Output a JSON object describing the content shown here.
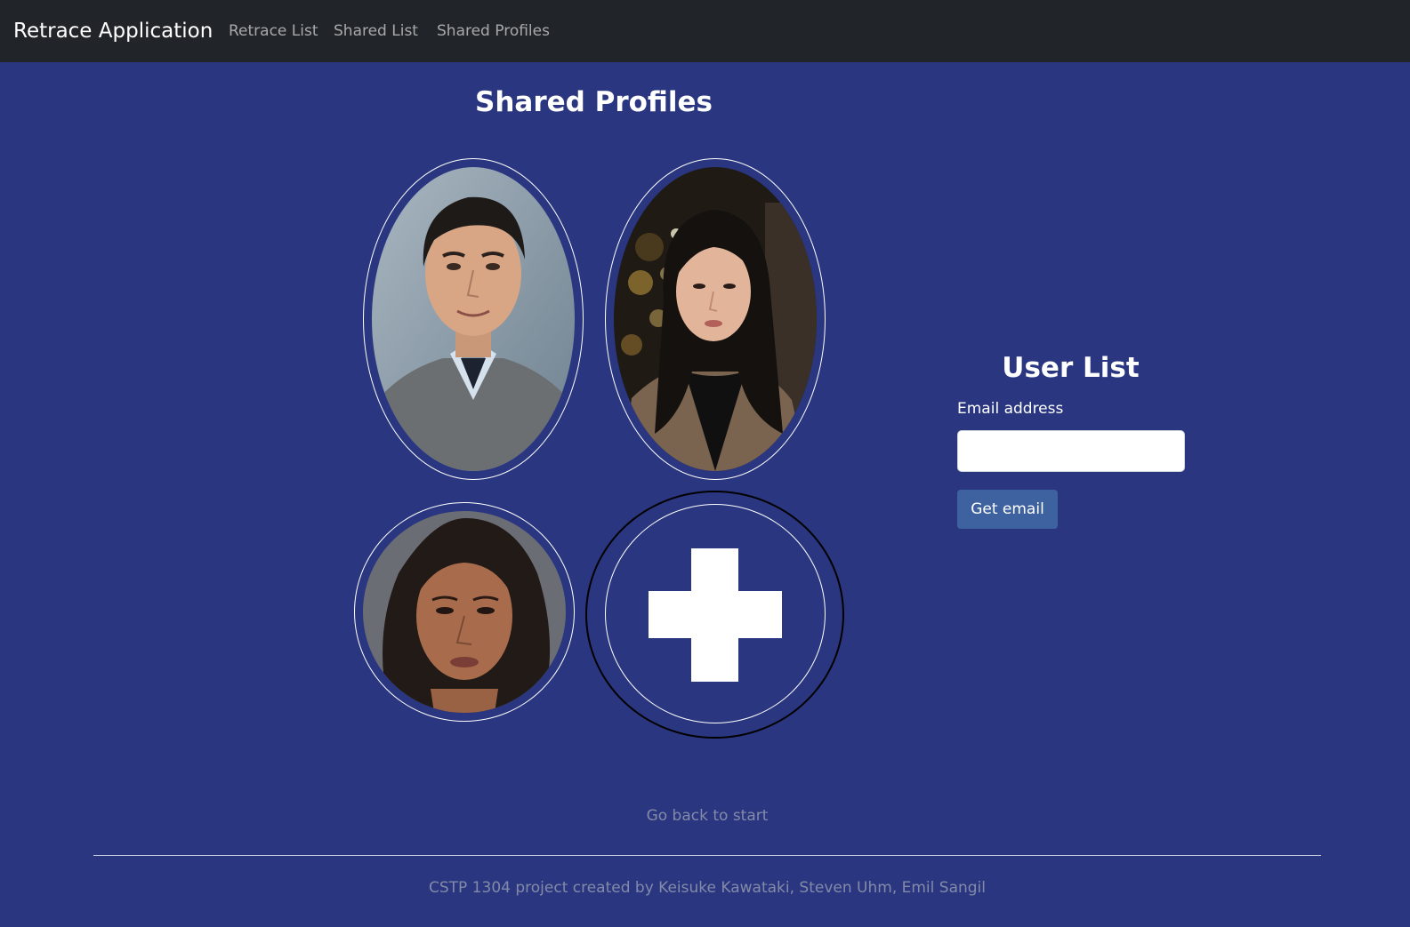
{
  "navbar": {
    "brand": "Retrace Application",
    "links": [
      {
        "label": "Retrace List"
      },
      {
        "label": "Shared List"
      },
      {
        "label": "Shared Profiles"
      }
    ]
  },
  "main": {
    "title": "Shared Profiles",
    "profiles": [
      {
        "photo": "man-portrait-photo"
      },
      {
        "photo": "woman-portrait-photo"
      },
      {
        "photo": "woman-portrait-photo"
      }
    ],
    "add_profile_icon": "plus-icon"
  },
  "user_list": {
    "title": "User List",
    "email_label": "Email address",
    "email_value": "",
    "button_label": "Get email"
  },
  "footer": {
    "back_link": "Go back to start",
    "credits": "CSTP 1304 project created by Keisuke Kawataki, Steven Uhm, Emil Sangil"
  },
  "colors": {
    "background": "#2a3780",
    "navbar": "#212529",
    "button": "#3e62a0",
    "muted_text": "#838aa8"
  }
}
